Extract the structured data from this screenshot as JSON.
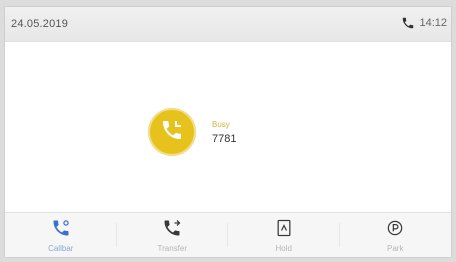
{
  "status_bar": {
    "date": "24.05.2019",
    "time": "14:12",
    "call_icon": "phone-icon"
  },
  "call": {
    "status": "Busy",
    "number": "7781",
    "avatar_icon": "phone-in-call-icon",
    "avatar_color": "#e7c21c"
  },
  "softkeys": [
    {
      "label": "Callbar",
      "icon": "phone-settings-icon",
      "active": true
    },
    {
      "label": "Transfer",
      "icon": "phone-forward-icon",
      "active": false
    },
    {
      "label": "Hold",
      "icon": "hold-icon",
      "active": false
    },
    {
      "label": "Park",
      "icon": "park-icon",
      "active": false
    }
  ],
  "colors": {
    "accent": "#e7c21c",
    "active_softkey": "#3d6fd1",
    "inactive_softkey": "#3a3a3a"
  }
}
